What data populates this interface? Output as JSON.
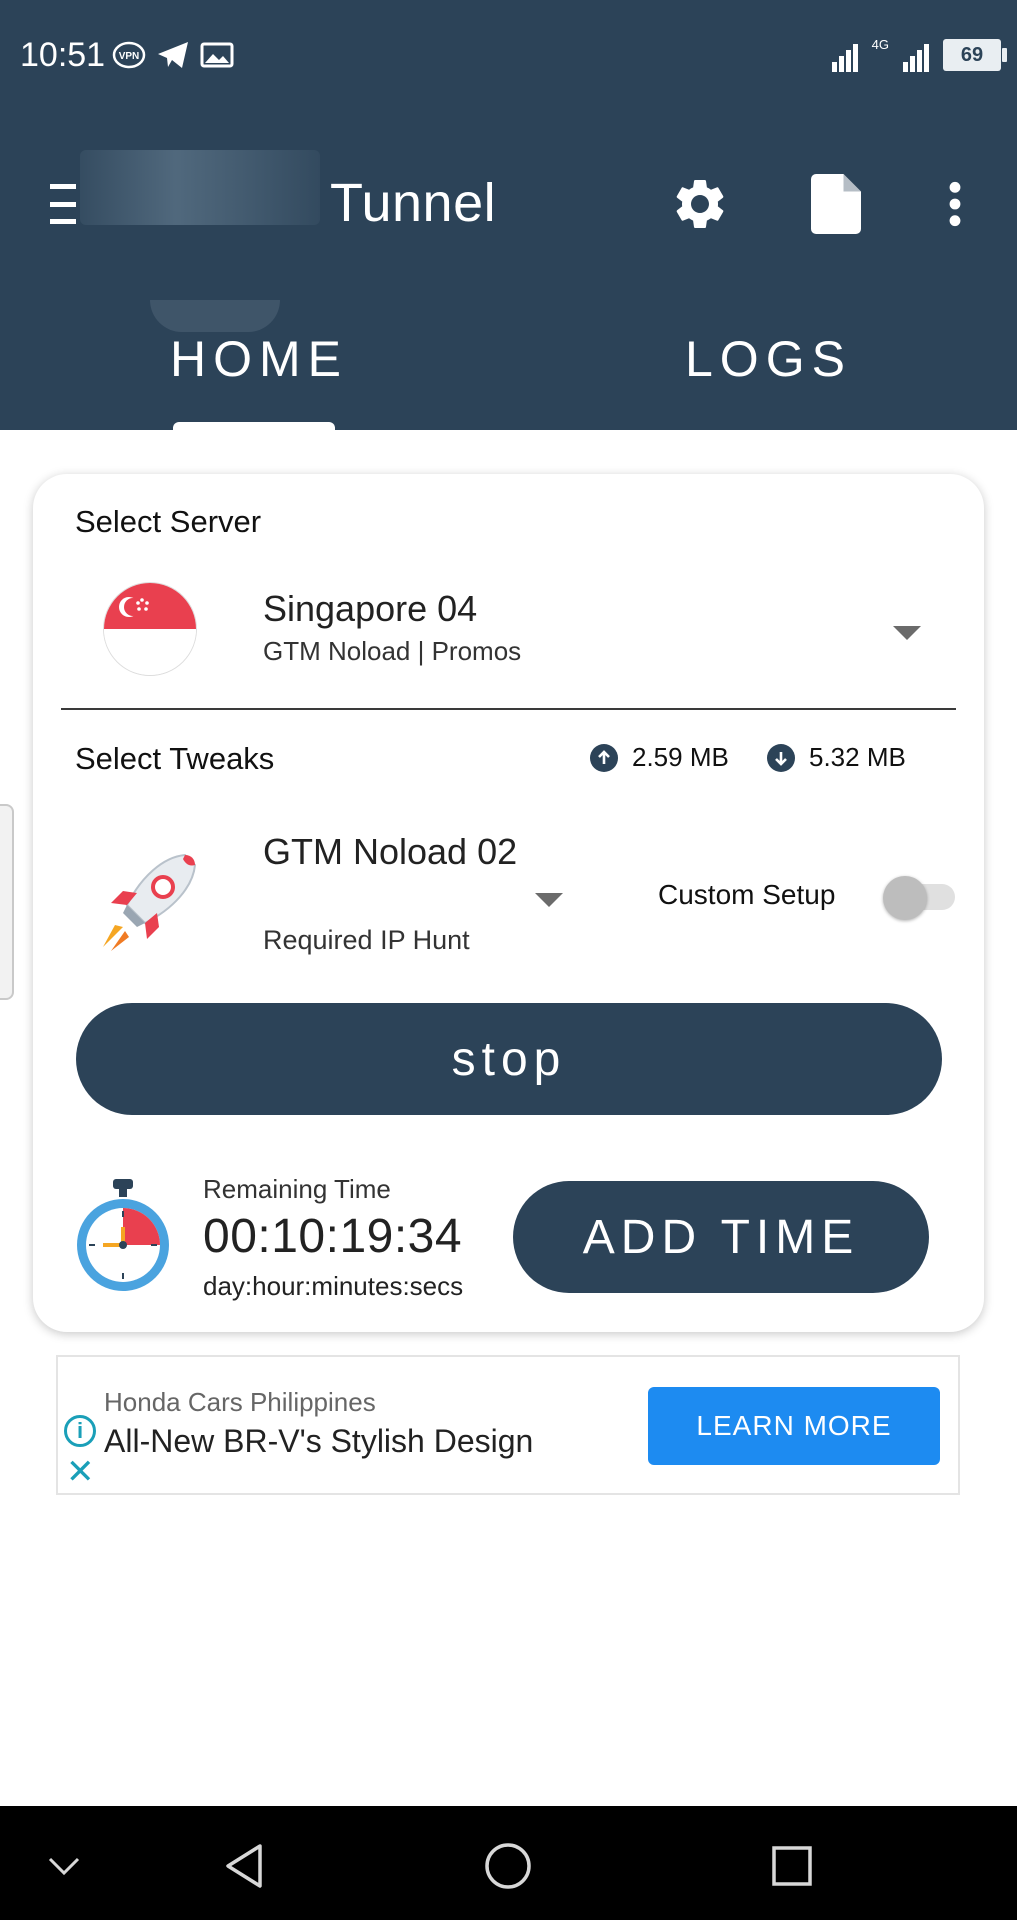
{
  "status_bar": {
    "time": "10:51",
    "vpn_label": "VPN",
    "battery": "69"
  },
  "toolbar": {
    "title": "Tunnel",
    "icons": [
      "menu-icon",
      "gear-icon",
      "document-icon",
      "more-vertical-icon"
    ]
  },
  "tabs": [
    {
      "label": "HOME",
      "active": true
    },
    {
      "label": "LOGS",
      "active": false
    }
  ],
  "server": {
    "section_label": "Select Server",
    "name": "Singapore 04",
    "subtitle": "GTM Noload | Promos",
    "flag_icon": "singapore-flag-icon"
  },
  "tweaks": {
    "section_label": "Select Tweaks",
    "upload": "2.59 MB",
    "download": "5.32 MB",
    "name": "GTM Noload 02",
    "subtitle": "Required IP Hunt",
    "icon": "rocket-icon",
    "custom_setup_label": "Custom Setup",
    "custom_setup_enabled": false
  },
  "stop_button": "stop",
  "timer": {
    "label": "Remaining Time",
    "value": "00:10:19:34",
    "format": "day:hour:minutes:secs",
    "add_time_label": "ADD TIME"
  },
  "ad": {
    "advertiser": "Honda Cars Philippines",
    "headline": "All-New BR-V's Stylish Design",
    "cta": "LEARN MORE",
    "info_icon": "i"
  },
  "colors": {
    "primary": "#2c4358",
    "ad_cta": "#1d8bf1",
    "ad_accent": "#1a9fb8"
  }
}
